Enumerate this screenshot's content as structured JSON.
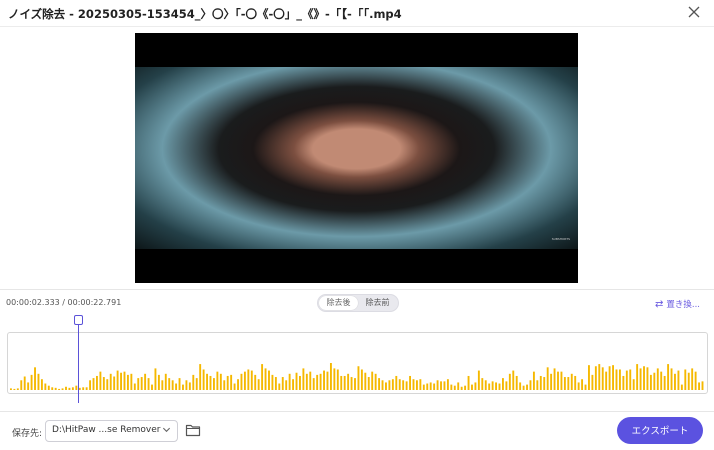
{
  "window": {
    "title": "ノイズ除去 - 20250305-153454_〉〇〉「-〇《-〇」_《》-「【-「「.mp4"
  },
  "video": {
    "watermark": "SUBSHORTS"
  },
  "editor": {
    "current_time": "00:00:02.333",
    "total_time": "/ 00:00:22.791",
    "toggle_after": "除去後",
    "toggle_before": "除去前",
    "replace_label": "置き換..."
  },
  "waveform": {
    "color": "#f5b800",
    "bars": [
      0.03,
      0.02,
      0.03,
      0.18,
      0.25,
      0.14,
      0.28,
      0.42,
      0.3,
      0.2,
      0.12,
      0.08,
      0.05,
      0.04,
      0.02,
      0.03,
      0.06,
      0.04,
      0.05,
      0.08,
      0.04,
      0.05,
      0.05,
      0.18,
      0.22,
      0.26,
      0.34,
      0.24,
      0.2,
      0.3,
      0.25,
      0.36,
      0.32,
      0.34,
      0.28,
      0.3,
      0.12,
      0.22,
      0.24,
      0.3,
      0.22,
      0.1,
      0.4,
      0.28,
      0.18,
      0.3,
      0.22,
      0.18,
      0.12,
      0.22,
      0.1,
      0.18,
      0.14,
      0.28,
      0.22,
      0.48,
      0.38,
      0.3,
      0.26,
      0.22,
      0.34,
      0.3,
      0.18,
      0.26,
      0.28,
      0.12,
      0.2,
      0.3,
      0.34,
      0.38,
      0.36,
      0.28,
      0.2,
      0.48,
      0.4,
      0.36,
      0.28,
      0.24,
      0.12,
      0.24,
      0.18,
      0.3,
      0.2,
      0.32,
      0.26,
      0.4,
      0.3,
      0.34,
      0.22,
      0.28,
      0.3,
      0.36,
      0.34,
      0.5,
      0.4,
      0.38,
      0.26,
      0.26,
      0.3,
      0.24,
      0.22,
      0.44,
      0.38,
      0.32,
      0.24,
      0.34,
      0.3,
      0.22,
      0.18,
      0.14,
      0.18,
      0.2,
      0.26,
      0.2,
      0.18,
      0.16,
      0.26,
      0.2,
      0.18,
      0.2,
      0.1,
      0.12,
      0.14,
      0.12,
      0.18,
      0.16,
      0.16,
      0.2,
      0.1,
      0.08,
      0.14,
      0.06,
      0.08,
      0.26,
      0.1,
      0.14,
      0.36,
      0.22,
      0.18,
      0.12,
      0.16,
      0.14,
      0.12,
      0.22,
      0.16,
      0.3,
      0.36,
      0.26,
      0.14,
      0.08,
      0.1,
      0.18,
      0.34,
      0.18,
      0.26,
      0.24,
      0.42,
      0.3,
      0.4,
      0.34,
      0.34,
      0.24,
      0.24,
      0.3,
      0.26,
      0.14,
      0.2,
      0.1,
      0.46,
      0.28,
      0.44,
      0.48,
      0.42,
      0.34,
      0.44,
      0.46,
      0.38,
      0.38,
      0.26,
      0.36,
      0.38,
      0.2,
      0.48,
      0.4,
      0.44,
      0.42,
      0.28,
      0.32,
      0.4,
      0.34,
      0.26,
      0.48,
      0.4,
      0.3,
      0.36,
      0.1,
      0.38,
      0.32,
      0.4,
      0.34,
      0.14,
      0.16
    ]
  },
  "footer": {
    "save_to_label": "保存先:",
    "save_path": "D:\\HitPaw ...se Remover",
    "export_label": "エクスポート"
  },
  "colors": {
    "accent": "#5b52e0",
    "waveform": "#f5b800"
  }
}
